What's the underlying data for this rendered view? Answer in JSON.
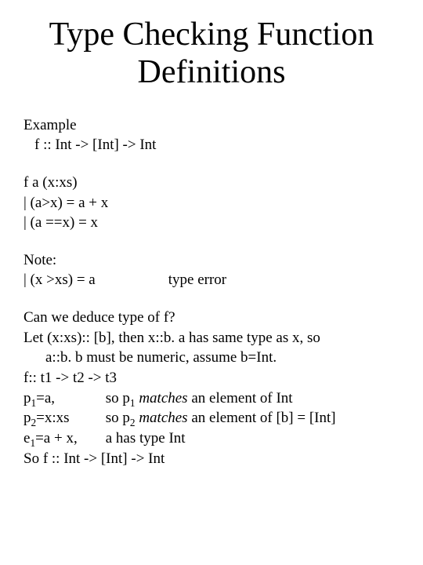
{
  "title": "Type Checking Function Definitions",
  "example": {
    "label": "Example",
    "sig": "f :: Int -> [Int] -> Int"
  },
  "defn": {
    "head": "f a (x:xs)",
    "g1": " | (a>x) = a + x",
    "g2": " | (a ==x) = x"
  },
  "note": {
    "label": "Note:",
    "guard": " | (x >xs) = a",
    "err": "type error"
  },
  "deduce": {
    "q": "Can we deduce type of f?",
    "let1a": "Let (x:xs):: [b],   then x::b.  a has same type as x, so",
    "let1b": "a::b.  b must be numeric, assume b=Int.",
    "ftype": "f:: t1 -> t2 -> t3",
    "p1_lhs": "p",
    "p1_sub": "1",
    "p1_eq": "=a,",
    "p1_so": "so  p",
    "p1_sub2": "1",
    "p1_matches": " matches",
    "p1_rest": " an element of Int",
    "p2_lhs": "p",
    "p2_sub": "2",
    "p2_eq": "=x:xs",
    "p2_so": "so   p",
    "p2_sub2": "2",
    "p2_matches": " matches",
    "p2_rest": " an element of [b] = [Int]",
    "e1_lhs": "e",
    "e1_sub": "1",
    "e1_eq": "=a + x,",
    "e1_rest": "a    has type Int",
    "final": "So f :: Int -> [Int] -> Int"
  }
}
